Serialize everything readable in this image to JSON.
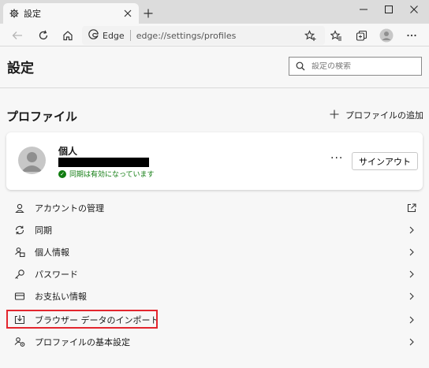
{
  "tab": {
    "title": "設定"
  },
  "address_bar": {
    "site_label": "Edge",
    "url": "edge://settings/profiles"
  },
  "page": {
    "title": "設定",
    "search_placeholder": "設定の検索"
  },
  "profiles": {
    "section_title": "プロファイル",
    "add_profile_label": "プロファイルの追加",
    "card": {
      "name": "個人",
      "sync_status": "同期は有効になっています",
      "more_label": "···",
      "signout_label": "サインアウト"
    }
  },
  "settings_list": [
    {
      "label": "アカウントの管理",
      "icon": "account-icon",
      "trail": "external-link-icon"
    },
    {
      "label": "同期",
      "icon": "sync-icon",
      "trail": "chevron-right-icon"
    },
    {
      "label": "個人情報",
      "icon": "personal-info-icon",
      "trail": "chevron-right-icon"
    },
    {
      "label": "パスワード",
      "icon": "key-icon",
      "trail": "chevron-right-icon"
    },
    {
      "label": "お支払い情報",
      "icon": "credit-card-icon",
      "trail": "chevron-right-icon"
    },
    {
      "label": "ブラウザー データのインポート",
      "icon": "import-icon",
      "trail": "chevron-right-icon",
      "highlighted": true
    },
    {
      "label": "プロファイルの基本設定",
      "icon": "profile-settings-icon",
      "trail": "chevron-right-icon"
    }
  ],
  "colors": {
    "highlight": "#e3262e",
    "sync_green": "#107c10",
    "background": "#f7f7f7"
  }
}
